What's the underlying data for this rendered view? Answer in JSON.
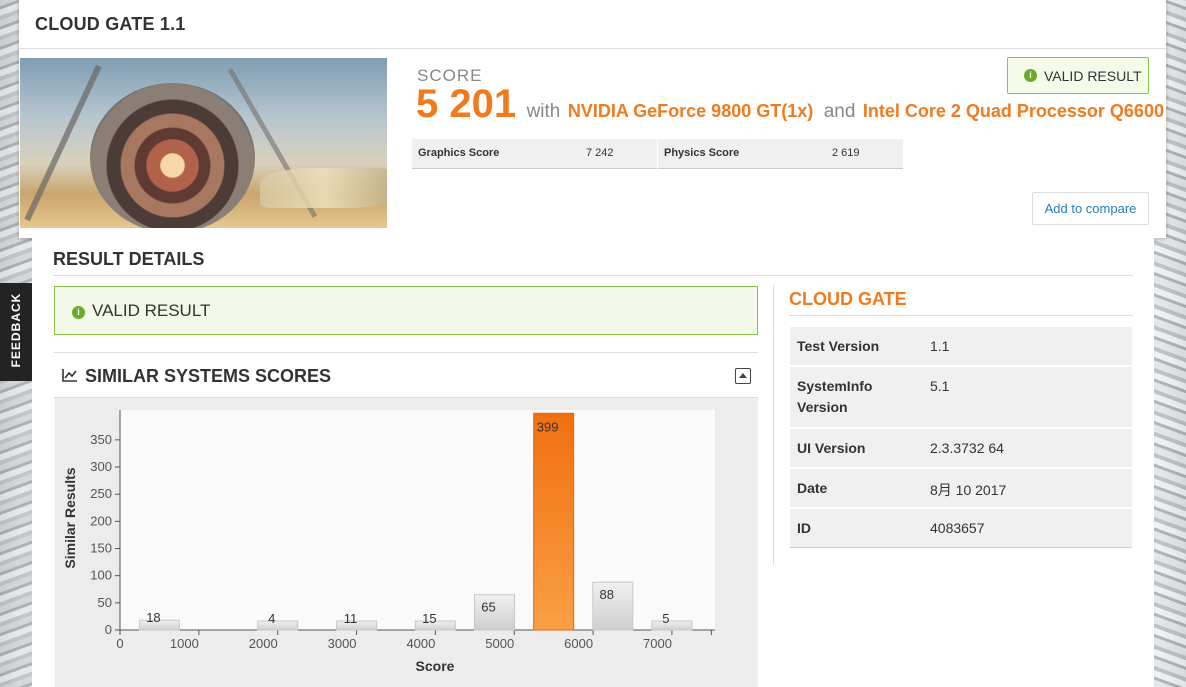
{
  "header": {
    "title": "CLOUD GATE 1.1"
  },
  "score": {
    "label": "SCORE",
    "value": "5 201",
    "with": "with",
    "gpu": "NVIDIA GeForce 9800 GT(1x)",
    "and": "and",
    "cpu": "Intel Core 2 Quad Processor Q6600",
    "graphics_label": "Graphics Score",
    "graphics_value": "7 242",
    "physics_label": "Physics Score",
    "physics_value": "2 619"
  },
  "buttons": {
    "valid": "VALID RESULT",
    "compare": "Add to compare"
  },
  "feedback": "FEEDBACK",
  "details": {
    "title": "RESULT DETAILS",
    "valid": "VALID RESULT",
    "similar_title": "SIMILAR SYSTEMS SCORES"
  },
  "cloudgate": {
    "title": "CLOUD GATE",
    "rows": [
      {
        "k": "Test Version",
        "v": "1.1"
      },
      {
        "k": "SystemInfo Version",
        "v": "5.1"
      },
      {
        "k": "UI Version",
        "v": "2.3.3732 64"
      },
      {
        "k": "Date",
        "v": "8月 10 2017"
      },
      {
        "k": "ID",
        "v": "4083657"
      }
    ]
  },
  "colors": {
    "accent": "#f07b1f",
    "valid_green": "#6aab2b",
    "link": "#2a7ab8"
  },
  "chart_data": {
    "type": "bar",
    "xlabel": "Score",
    "ylabel": "Similar Results",
    "xlim": [
      0,
      7500
    ],
    "ylim": [
      0,
      400
    ],
    "x_ticks": [
      0,
      1000,
      2000,
      3000,
      4000,
      5000,
      6000,
      7000
    ],
    "y_ticks": [
      0,
      50,
      100,
      150,
      200,
      250,
      300,
      350
    ],
    "bins": [
      {
        "x": 500,
        "value": 18
      },
      {
        "x": 2000,
        "value": 4
      },
      {
        "x": 3000,
        "value": 11
      },
      {
        "x": 4000,
        "value": 15
      },
      {
        "x": 4750,
        "value": 65
      },
      {
        "x": 5500,
        "value": 399,
        "highlight": true
      },
      {
        "x": 6250,
        "value": 88
      },
      {
        "x": 7000,
        "value": 5
      }
    ]
  }
}
